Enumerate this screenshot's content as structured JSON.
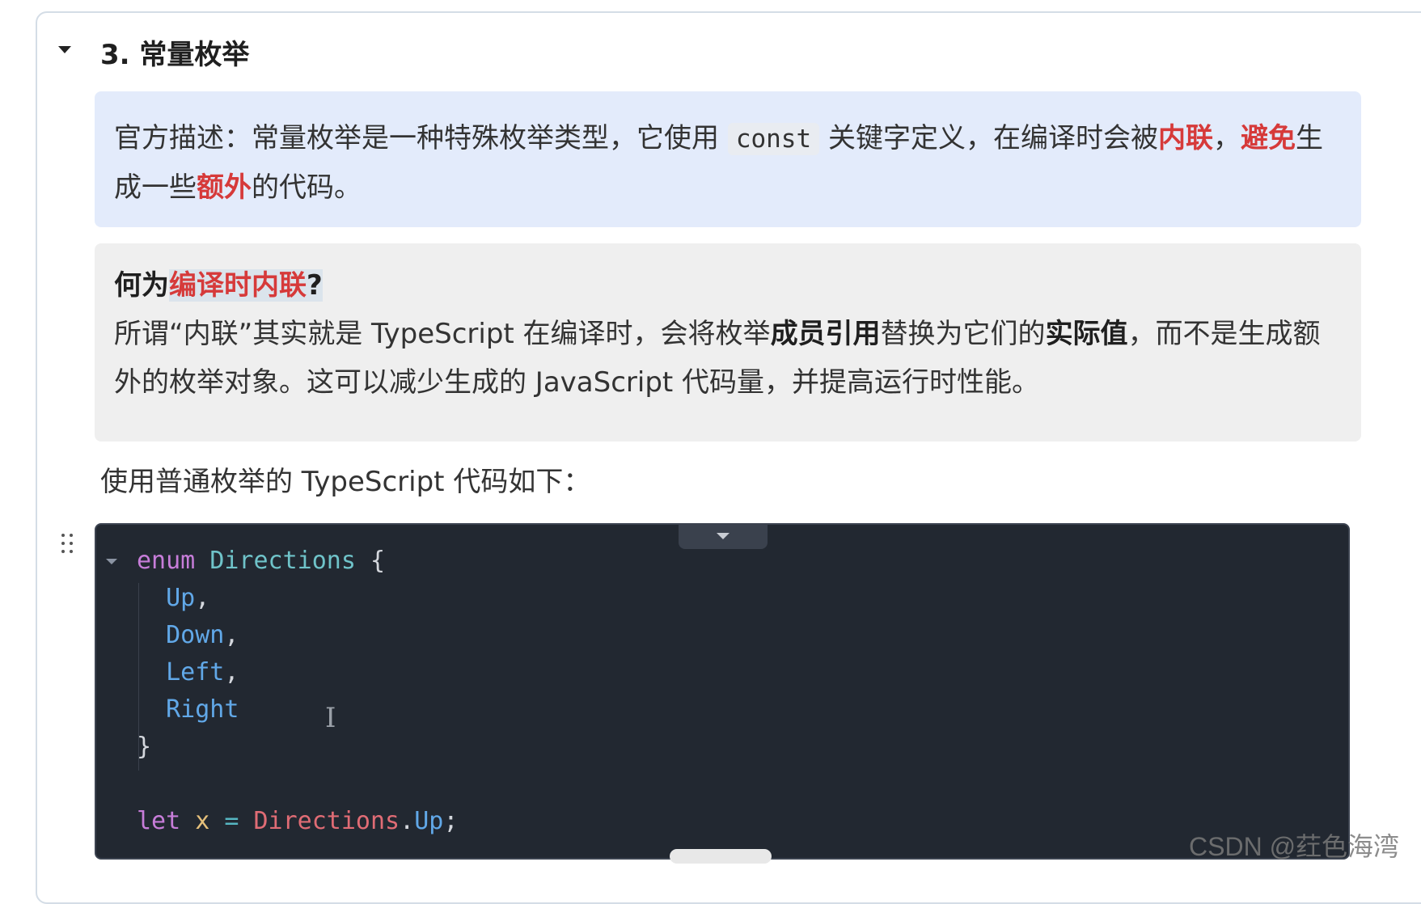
{
  "section": {
    "heading": "3. 常量枚举"
  },
  "callout_blue": {
    "p1": "官方描述：常量枚举是一种特殊枚举类型，它使用",
    "code": "const",
    "p2": "关键字定义，在编译时会被",
    "hl1": "内联",
    "p3": "，",
    "hl2": "避免",
    "p4": "生成一些",
    "hl3": "额外",
    "p5": "的代码。"
  },
  "callout_gray": {
    "q_prefix": "何为",
    "q_hl": "编译时内联",
    "q_suffix": "?",
    "t1": "所谓“内联”其实就是 TypeScript 在编译时，会将枚举",
    "b1": "成员引用",
    "t2": "替换为它们的",
    "b2": "实际值",
    "t3": "，而不是生成额外的枚举对象。这可以减少生成的 JavaScript 代码量，并提高运行时性能。"
  },
  "plain_text": "使用普通枚举的 TypeScript 代码如下：",
  "code": {
    "kw_enum": "enum",
    "type_name": "Directions",
    "open_brace": "{",
    "members": [
      "Up",
      "Down",
      "Left",
      "Right"
    ],
    "close_brace": "}",
    "kw_let": "let",
    "var_name": "x",
    "op_eq": "=",
    "obj_ref": "Directions",
    "dot": ".",
    "prop": "Up",
    "semi": ";"
  },
  "watermark": "CSDN @荭色海湾"
}
